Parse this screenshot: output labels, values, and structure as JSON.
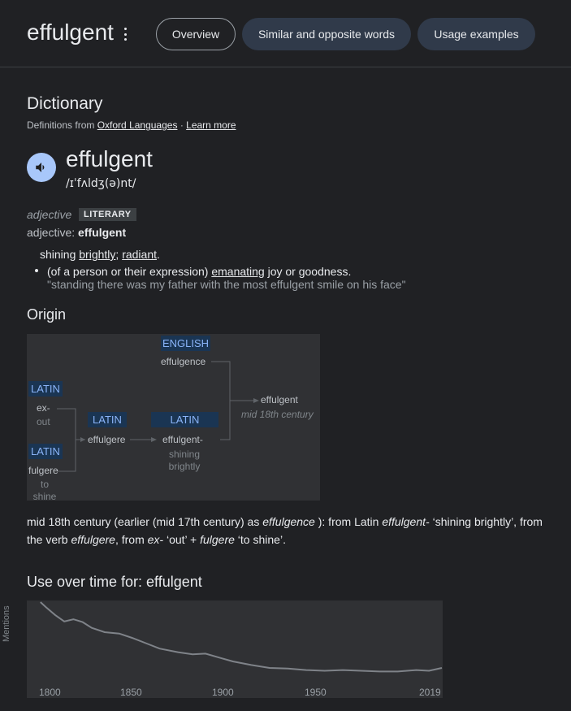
{
  "header": {
    "word": "effulgent",
    "tabs": [
      {
        "label": "Overview",
        "active": true
      },
      {
        "label": "Similar and opposite words",
        "active": false
      },
      {
        "label": "Usage examples",
        "active": false
      }
    ]
  },
  "dictionary": {
    "title": "Dictionary",
    "source_prefix": "Definitions from",
    "source_link": "Oxford Languages",
    "separator": "·",
    "learn_more": "Learn more",
    "headword": "effulgent",
    "phonetic": "/ɪˈfʌldʒ(ə)nt/",
    "pos": "adjective",
    "register": "LITERARY",
    "pos_line_label": "adjective:",
    "pos_line_word": "effulgent",
    "def1": {
      "pre": "shining ",
      "link1": "brightly",
      "mid": "; ",
      "link2": "radiant",
      "post": "."
    },
    "def2": {
      "pre": "(of a person or their expression) ",
      "link": "emanating",
      "post": " joy or goodness."
    },
    "example": "\"standing there was my father with the most effulgent smile on his face\""
  },
  "origin": {
    "title": "Origin",
    "diagram": {
      "english_tag": "ENGLISH",
      "english_word": "effulgence",
      "latin1_tag": "LATIN",
      "latin1_word1": "ex-",
      "latin1_gloss": "out",
      "latin2_tag": "LATIN",
      "latin2_word": "fulgere",
      "latin2_gloss1": "to",
      "latin2_gloss2": "shine",
      "latin3_tag": "LATIN",
      "latin3_word": "effulgere",
      "latin4_tag": "LATIN",
      "latin4_word": "effulgent-",
      "latin4_gloss1": "shining",
      "latin4_gloss2": "brightly",
      "result_word": "effulgent",
      "result_date": "mid 18th century"
    },
    "text": {
      "p1": "mid 18th century (earlier (mid 17th century) as ",
      "i1": "effulgence",
      "p2": " ): from Latin ",
      "i2": "effulgent-",
      "p3": " ‘shining brightly’, from the verb ",
      "i3": "effulgere",
      "p4": ", from ",
      "i4": "ex-",
      "p5": " ‘out’ + ",
      "i5": "fulgere",
      "p6": " ‘to shine’."
    }
  },
  "usage": {
    "title": "Use over time for: effulgent",
    "ylabel": "Mentions",
    "xticks": [
      "1800",
      "1850",
      "1900",
      "1950",
      "2019"
    ]
  },
  "chart_data": {
    "type": "line",
    "title": "Use over time for: effulgent",
    "xlabel": "",
    "ylabel": "Mentions",
    "xlim": [
      1793,
      2019
    ],
    "ylim": [
      0,
      1
    ],
    "grid": false,
    "series": [
      {
        "x": [
          1800,
          1803,
          1808,
          1813,
          1818,
          1823,
          1828,
          1835,
          1843,
          1850,
          1858,
          1865,
          1875,
          1883,
          1890,
          1898,
          1905,
          1915,
          1925,
          1935,
          1945,
          1955,
          1965,
          1975,
          1985,
          1995,
          2005,
          2012,
          2019
        ],
        "values": [
          1.0,
          0.93,
          0.82,
          0.73,
          0.76,
          0.72,
          0.64,
          0.58,
          0.56,
          0.5,
          0.42,
          0.35,
          0.3,
          0.27,
          0.28,
          0.22,
          0.17,
          0.12,
          0.08,
          0.07,
          0.05,
          0.04,
          0.05,
          0.04,
          0.03,
          0.03,
          0.05,
          0.04,
          0.08
        ]
      }
    ]
  }
}
